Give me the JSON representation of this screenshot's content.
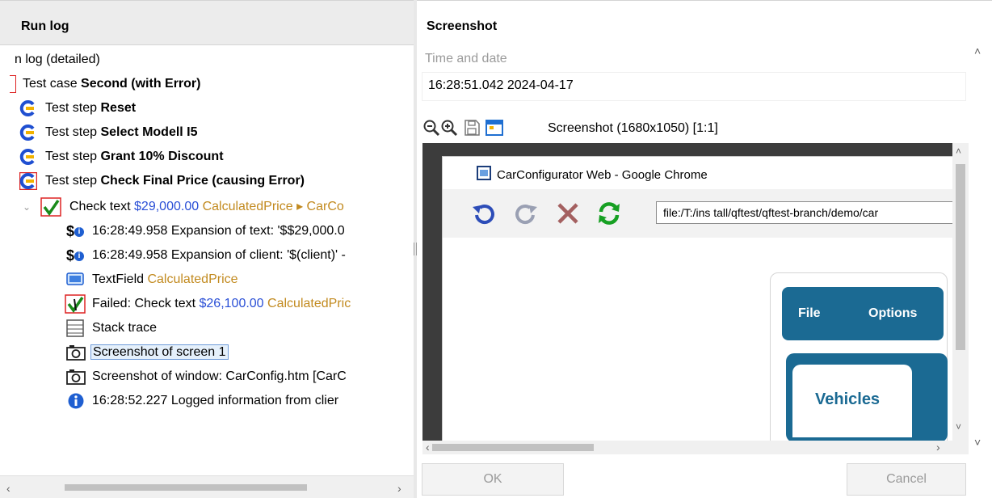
{
  "left_panel": {
    "title": "Run log",
    "tree": {
      "root": "​n log (detailed)",
      "test_case_prefix": "Test case ",
      "test_case_name": "Second (with Error)",
      "steps": [
        {
          "prefix": "Test step ",
          "name": "Reset"
        },
        {
          "prefix": "Test step ",
          "name": "Select Modell I5"
        },
        {
          "prefix": "Test step ",
          "name": "Grant 10% Discount"
        },
        {
          "prefix": "Test step ",
          "name": "Check Final Price (causing Error)"
        }
      ],
      "check_text": {
        "prefix": "Check text ",
        "value": "$29,000.00",
        "component": "CalculatedPrice ▸ CarCo"
      },
      "expansion_1": "16:28:49.958 Expansion of text: '$$29,000.0",
      "expansion_2": "16:28:49.958 Expansion of client: '$(client)' -",
      "textfield": {
        "prefix": "TextField ",
        "name": "CalculatedPrice"
      },
      "failed": {
        "prefix": "Failed: Check text ",
        "value": "$26,100.00",
        "component": "CalculatedPric"
      },
      "stack_trace": "Stack trace",
      "screenshot_screen": "Screenshot of screen 1",
      "screenshot_window": "Screenshot of window: CarConfig.htm [CarC",
      "logged_info": "16:28:52.227 Logged information from clier"
    }
  },
  "right_panel": {
    "title": "Screenshot",
    "time_label": "Time and date",
    "time_value": "16:28:51.042  2024-04-17",
    "screenshot_info": "Screenshot (1680x1050) [1:1]",
    "browser": {
      "window_title": "CarConfigurator Web - Google Chrome",
      "url": "file:/T:/ins tall/qftest/qftest-branch/demo/car",
      "menu_file": "File",
      "menu_options": "Options",
      "tab_vehicles": "Vehicles"
    },
    "buttons": {
      "ok": "OK",
      "cancel": "Cancel"
    }
  },
  "colors": {
    "highlight_blue": "#2a4fd6",
    "component_orange": "#c28a1f",
    "web_header_blue": "#1b6a93"
  }
}
